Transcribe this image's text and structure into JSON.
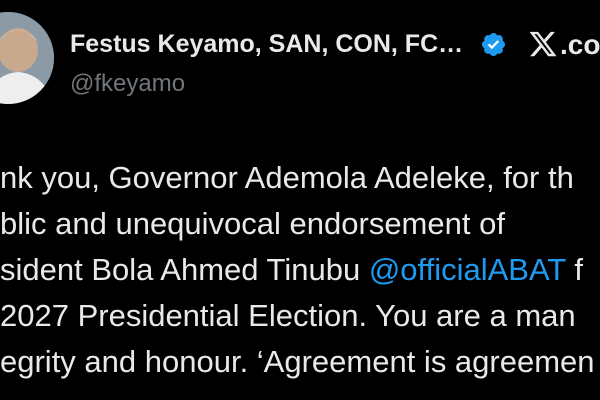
{
  "author": {
    "display_name": "Festus Keyamo, SAN, CON, FC…",
    "handle": "@fkeyamo",
    "verified_icon": "verified-badge-icon",
    "avatar_icon": "profile-photo"
  },
  "brand": {
    "logo_icon": "x-logo-icon",
    "tld": ".co"
  },
  "tweet": {
    "lines": [
      {
        "text": "nk you, Governor Ademola Adeleke, for th"
      },
      {
        "text": "blic and unequivocal endorsement of"
      },
      {
        "before": "sident Bola Ahmed Tinubu ",
        "mention": "@officialABAT",
        "after": " f"
      },
      {
        "text": "2027 Presidential Election. You are a man"
      },
      {
        "text": "egrity and honour. ‘Agreement is agreemen"
      }
    ]
  },
  "colors": {
    "background": "#000000",
    "text_primary": "#e7e9ea",
    "text_secondary": "#71767b",
    "link": "#1d9bf0",
    "verified": "#1d9bf0"
  }
}
